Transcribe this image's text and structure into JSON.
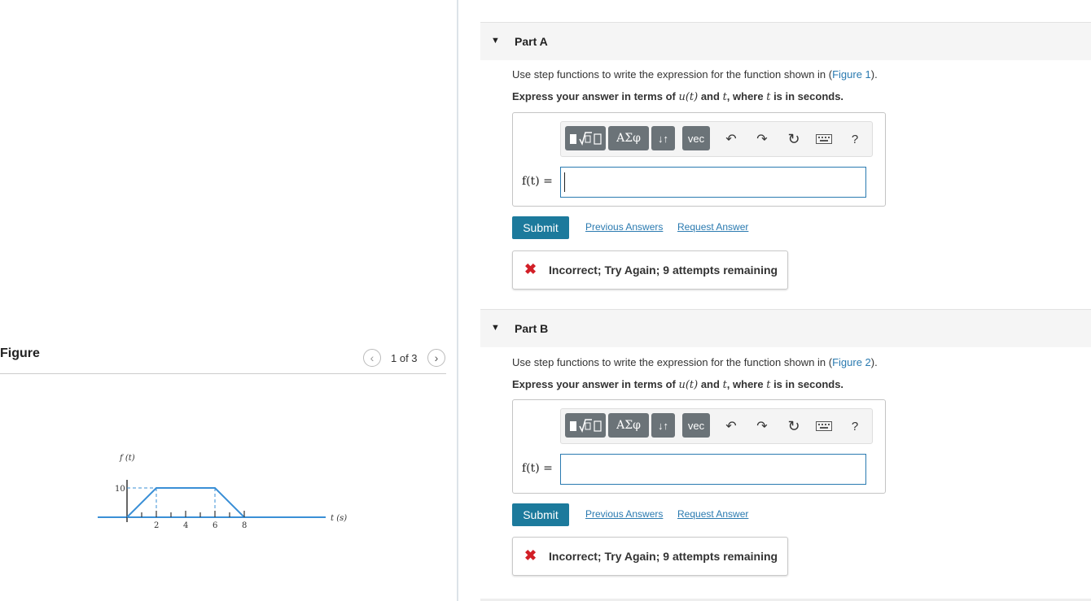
{
  "figure": {
    "title": "Figure",
    "pager": "1 of 3",
    "prev_icon": "chevron-left-icon",
    "next_icon": "chevron-right-icon",
    "graph": {
      "y_label": "f (t)",
      "x_label": "t (s)",
      "y_tick": "10",
      "x_ticks": [
        "2",
        "4",
        "6",
        "8"
      ]
    }
  },
  "parts": [
    {
      "label": "Part A",
      "prompt_pre": "Use step functions to write the expression for the function shown in (",
      "prompt_link": "Figure 1",
      "prompt_post": ").",
      "instr_pre": "Express your answer in terms of ",
      "instr_u": "u(t)",
      "instr_and": " and ",
      "instr_t": "t",
      "instr_where": ", where ",
      "instr_t2": "t",
      "instr_post": " is in seconds.",
      "answer_label": "f(t) =",
      "answer_value": "",
      "submit": "Submit",
      "previous_answers": "Previous Answers",
      "request_answer": "Request Answer",
      "feedback": "Incorrect; Try Again; 9 attempts remaining"
    },
    {
      "label": "Part B",
      "prompt_pre": "Use step functions to write the expression for the function shown in (",
      "prompt_link": "Figure 2",
      "prompt_post": ").",
      "instr_pre": "Express your answer in terms of ",
      "instr_u": "u(t)",
      "instr_and": " and ",
      "instr_t": "t",
      "instr_where": ", where ",
      "instr_t2": "t",
      "instr_post": " is in seconds.",
      "answer_label": "f(t) =",
      "answer_value": "",
      "submit": "Submit",
      "previous_answers": "Previous Answers",
      "request_answer": "Request Answer",
      "feedback": "Incorrect; Try Again; 9 attempts remaining"
    }
  ],
  "toolbar": {
    "greek": "ΑΣφ",
    "arrows": "↓↑",
    "vec": "vec",
    "help": "?"
  },
  "colors": {
    "accent": "#1c7a9c",
    "link": "#2a7ab0",
    "error": "#d21f27",
    "graph_line": "#3a8fd6"
  }
}
